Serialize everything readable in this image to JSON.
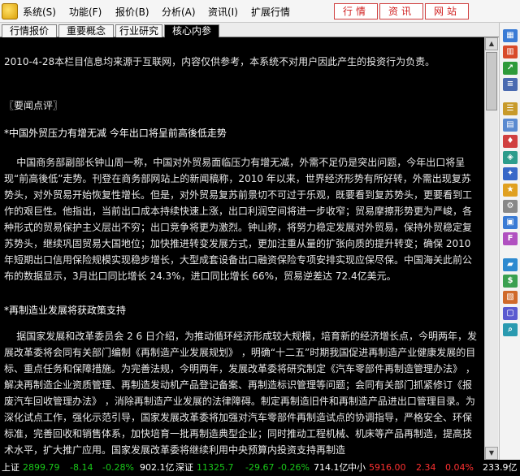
{
  "menu": {
    "items": [
      "系统(S)",
      "功能(F)",
      "报价(B)",
      "分析(A)",
      "资讯(I)",
      "扩展行情"
    ],
    "buttons": [
      "行情",
      "资讯",
      "网站"
    ]
  },
  "tabs": [
    "行情报价",
    "重要概念",
    "行业研究",
    "核心内参"
  ],
  "active_tab": "核心内参",
  "article": {
    "disclaimer": "2010-4-28本栏目信息均来源于互联网，内容仅供参考，本系统不对用户因此产生的投资行为负责。",
    "section": "〖要闻点评〗",
    "headline1": "*中国外贸压力有增无减 今年出口将呈前高後低走势",
    "body1": "    中国商务部副部长钟山周一称，中国对外贸易面临压力有增无减，外需不足仍是突出问题，今年出口将呈现“前高後低”走势。刊登在商务部网站上的新闻稿称，2010 年以来，世界经济形势有所好转，外需出现复苏势头，对外贸易开始恢复性增长。但是，对外贸易复苏前景切不可过于乐观，既要看到复苏势头，更要看到工作的艰巨性。他指出，当前出口成本持续快速上涨，出口利润空间将进一步收窄；贸易摩擦形势更为严峻，各种形式的贸易保护主义层出不穷；出口竞争将更为激烈。钟山称，将努力稳定发展对外贸易，保持外贸稳定复苏势头，继续巩固贸易大国地位；加快推进转变发展方式，更加注重从量的扩张向质的提升转变；确保 2010 年短期出口信用保险规模实现稳步增长，大型成套设备出口融资保险专项安排实现应保尽保。中国海关此前公布的数据显示，3月出口同比增长 24.3%，进口同比增长 66%，贸易逆差达 72.4亿美元。",
    "headline2": "*再制造业发展将获政策支持",
    "body2": "    据国家发展和改革委员会 2 6 日介绍，为推动循环经济形成较大规模，培育新的经济增长点，今明两年，发展改革委将会同有关部门编制《再制造产业发展规划》 ，明确“十二五”时期我国促进再制造产业健康发展的目标、重点任务和保障措施。为完善法规，今明两年，发展改革委将研究制定《汽车零部件再制造管理办法》 ，解决再制造企业资质管理、再制造发动机产品登记备案、再制造标识管理等问题；会同有关部门抓紧修订《报废汽车回收管理办法》 ，消除再制造产业发展的法律障碍。制定再制造旧件和再制造产品进出口管理目录。为深化试点工作，强化示范引导，国家发展改革委将加强对汽车零部件再制造试点的协调指导，严格安全、环保标准，完善回收和销售体系，加快培育一批再制造典型企业；同时推动工程机械、机床等产品再制造，提高技术水平，扩大推广应用。国家发展改革委将继续利用中央预算内投资支持再制造"
  },
  "status": {
    "sh_label": "上证",
    "sh_index": "2899.79",
    "sh_change": "-8.14",
    "sh_pct": "-0.28%",
    "sh_amount": "902.1亿",
    "sz_label": "深证",
    "sz_index": "11325.7",
    "sz_change": "-29.67",
    "sz_pct": "-0.26%",
    "sz_amount": "714.1亿",
    "sme_label": "中小",
    "sme_index": "5916.00",
    "sme_change": "2.34",
    "sme_pct": "0.04%",
    "sme_amount": "233.9亿"
  }
}
